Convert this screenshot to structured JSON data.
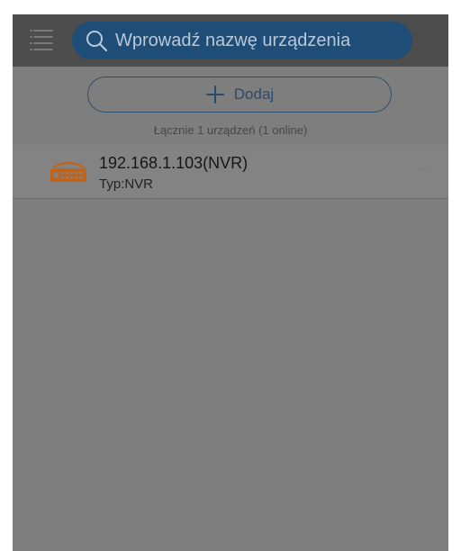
{
  "header": {
    "menu_icon": "hamburger-menu-icon",
    "search": {
      "placeholder": "Wprowadź nazwę urządzenia",
      "value": "",
      "icon": "search-icon"
    }
  },
  "actions": {
    "add_label": "Dodaj",
    "add_icon": "plus-icon"
  },
  "summary": {
    "count_text": "Łącznie 1 urządzeń (1 online)"
  },
  "devices": [
    {
      "name": "192.168.1.103(NVR)",
      "type": "Typ:NVR",
      "icon": "nvr-recorder-icon",
      "more": "···"
    }
  ],
  "colors": {
    "background": "#7e7e7e",
    "header": "#4d4d4d",
    "search_fill": "#1e4d78",
    "accent_blue": "#2b4a6a",
    "device_icon": "#c0641c"
  }
}
